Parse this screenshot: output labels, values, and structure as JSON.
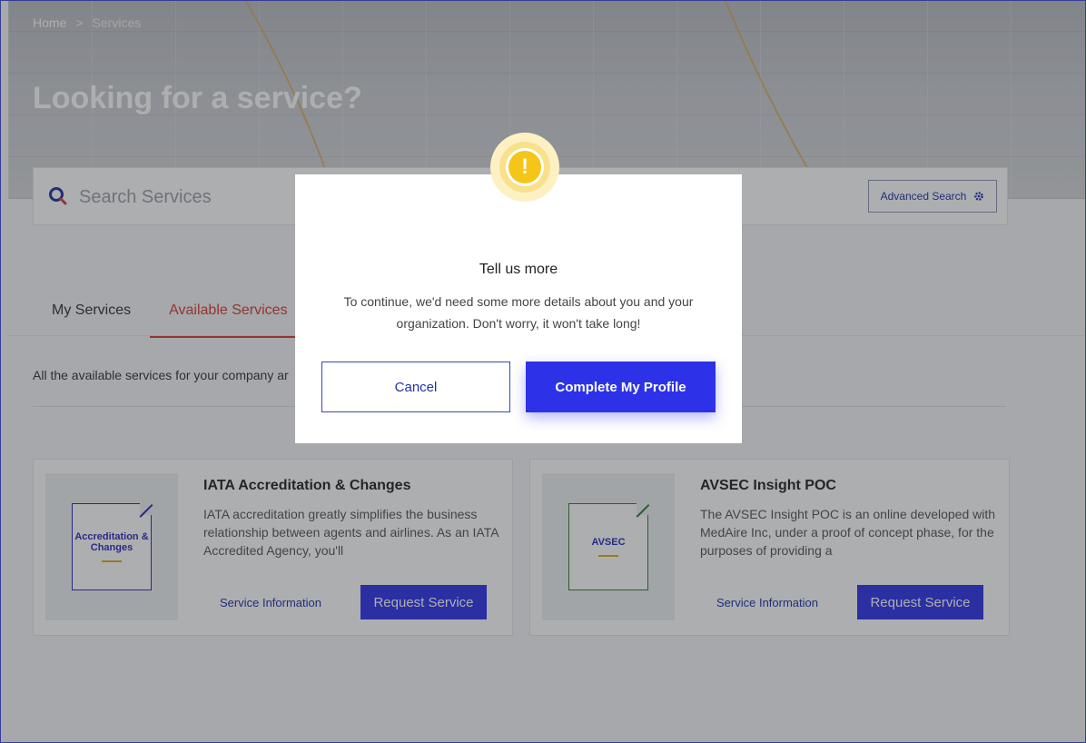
{
  "breadcrumb": {
    "home": "Home",
    "separator": ">",
    "current": "Services"
  },
  "hero": {
    "title": "Looking for a service?"
  },
  "search": {
    "placeholder": "Search Services",
    "advanced_label": "Advanced Search"
  },
  "tabs": [
    {
      "label": "My Services",
      "active": false
    },
    {
      "label": "Available Services",
      "active": true
    }
  ],
  "intro_text": "All the available services for your company ar",
  "cards": [
    {
      "thumb_label": "Accreditation & Changes",
      "thumb_color": "#2a2ab8",
      "title": "IATA Accreditation & Changes",
      "description": "IATA accreditation greatly simplifies the business relationship between agents and airlines. As an IATA Accredited Agency, you'll",
      "info_link": "Service Information",
      "request_button": "Request Service"
    },
    {
      "thumb_label": "AVSEC",
      "thumb_color": "#2e7d32",
      "title": "AVSEC Insight POC",
      "description": "The AVSEC Insight POC is an online developed with MedAire Inc, under a proof of concept phase, for the purposes of providing a",
      "info_link": "Service Information",
      "request_button": "Request Service"
    }
  ],
  "modal": {
    "icon": "exclamation-icon",
    "icon_glyph": "!",
    "title": "Tell us more",
    "body": "To continue, we'd need some more details about you and your organization. Don't worry, it won't take long!",
    "cancel_label": "Cancel",
    "confirm_label": "Complete My Profile"
  },
  "colors": {
    "accent": "#2d32e8",
    "tab_active": "#d83a33",
    "warning": "#f5c518",
    "link": "#1e32a6"
  }
}
